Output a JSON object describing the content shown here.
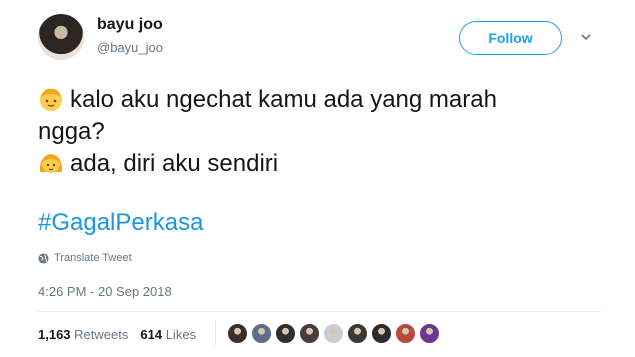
{
  "user": {
    "display_name": "bayu joo",
    "handle": "@bayu_joo"
  },
  "follow_label": "Follow",
  "tweet": {
    "line1_text": "kalo aku ngechat kamu ada yang marah",
    "line1_cont": "ngga?",
    "line2_text": "ada, diri aku sendiri",
    "line1_emoji": "boy-emoji",
    "line2_emoji": "girl-emoji",
    "hashtag": "#GagalPerkasa"
  },
  "translate_label": "Translate Tweet",
  "timestamp": "4:26 PM - 20 Sep 2018",
  "stats": {
    "retweets_count": "1,163",
    "retweets_label": "Retweets",
    "likes_count": "614",
    "likes_label": "Likes"
  },
  "colors": {
    "accent": "#1da1f2",
    "hashtag": "#1b95e0",
    "muted": "#657786"
  },
  "liker_avatars": [
    "#3a2f2b",
    "#5b6e8a",
    "#2e2e2e",
    "#4a3b3f",
    "#c9ced6",
    "#3d3a36",
    "#2b2b2b",
    "#b84a3c",
    "#6a3a8a"
  ]
}
